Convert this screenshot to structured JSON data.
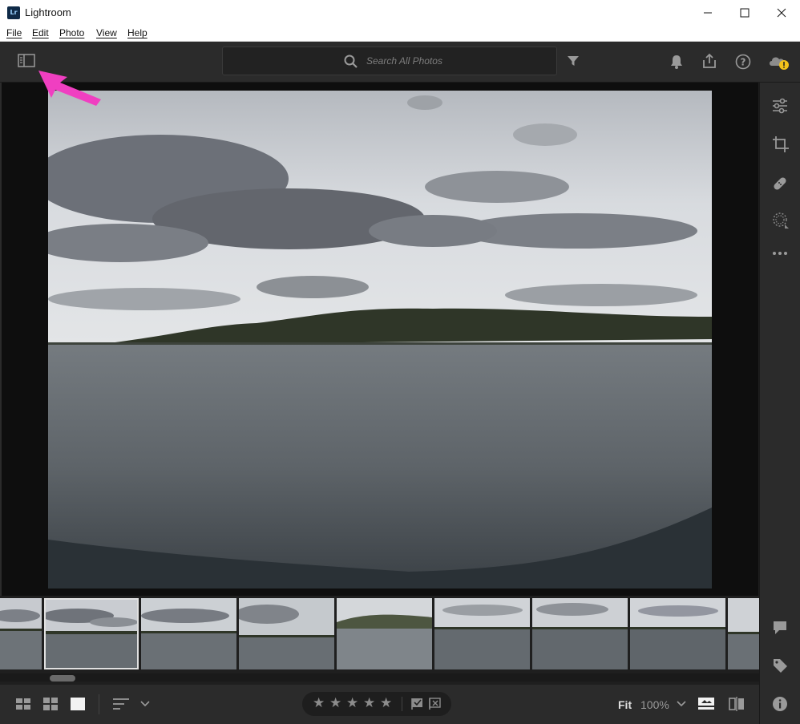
{
  "window": {
    "title": "Lightroom",
    "logo_text": "Lr",
    "minimize_icon": "minimize-icon",
    "maximize_icon": "maximize-icon",
    "close_icon": "close-icon"
  },
  "menu": {
    "items": [
      {
        "label": "File"
      },
      {
        "label": "Edit"
      },
      {
        "label": "Photo"
      },
      {
        "label": "View"
      },
      {
        "label": "Help"
      }
    ]
  },
  "toolbar": {
    "search_placeholder": "Search All Photos",
    "icons": [
      "panel-toggle-icon",
      "search-icon",
      "filter-icon",
      "bell-icon",
      "share-icon",
      "help-icon",
      "cloud-warning-icon"
    ]
  },
  "annotation": {
    "arrow_color": "#f03fc1"
  },
  "right_panel": {
    "tools": [
      "edit-sliders-icon",
      "crop-icon",
      "healing-icon",
      "masking-icon",
      "more-icon"
    ],
    "bottom_tools": [
      "comment-icon",
      "keyword-tag-icon",
      "info-icon"
    ]
  },
  "filmstrip": {
    "thumbnail_count": 9,
    "selected_index": 1
  },
  "bottombar": {
    "view_icons": [
      "grid-view-icon",
      "square-grid-view-icon",
      "detail-view-icon",
      "sort-icon"
    ],
    "rating_stars": [
      "★",
      "★",
      "★",
      "★",
      "★"
    ],
    "flag_icons": [
      "flag-pick-icon",
      "flag-reject-icon"
    ],
    "zoom_fit": "Fit",
    "zoom_percent": "100%",
    "right_icons": [
      "filmstrip-toggle-icon",
      "compare-icon"
    ]
  },
  "colors": {
    "accent": "#f03fc1",
    "panel": "#2b2b2b",
    "warning": "#f2c21b"
  }
}
